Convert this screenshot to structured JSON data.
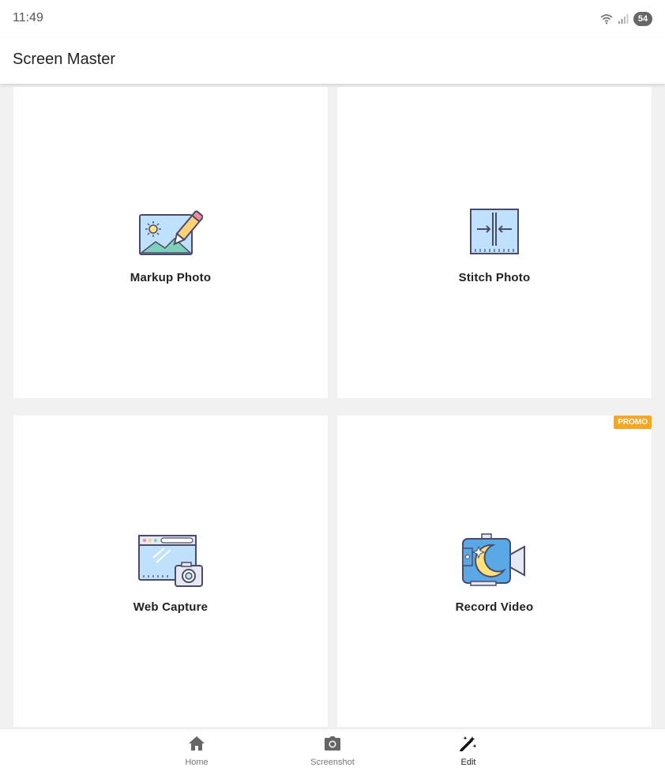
{
  "status_bar": {
    "time": "11:49",
    "battery": "54"
  },
  "app_bar": {
    "title": "Screen Master"
  },
  "cards": [
    {
      "label": "Markup Photo",
      "icon": "markup-photo-icon"
    },
    {
      "label": "Stitch Photo",
      "icon": "stitch-photo-icon"
    },
    {
      "label": "Web Capture",
      "icon": "web-capture-icon"
    },
    {
      "label": "Record Video",
      "icon": "record-video-icon",
      "badge": "PROMO"
    }
  ],
  "bottom_nav": {
    "items": [
      {
        "label": "Home",
        "icon": "home-icon"
      },
      {
        "label": "Screenshot",
        "icon": "camera-icon"
      },
      {
        "label": "Edit",
        "icon": "magic-wand-icon",
        "active": true
      }
    ]
  },
  "colors": {
    "promo": "#f5a623",
    "icon_blue": "#bfe1fb",
    "icon_outline": "#4a4a6a",
    "background": "#f1f1f1"
  }
}
